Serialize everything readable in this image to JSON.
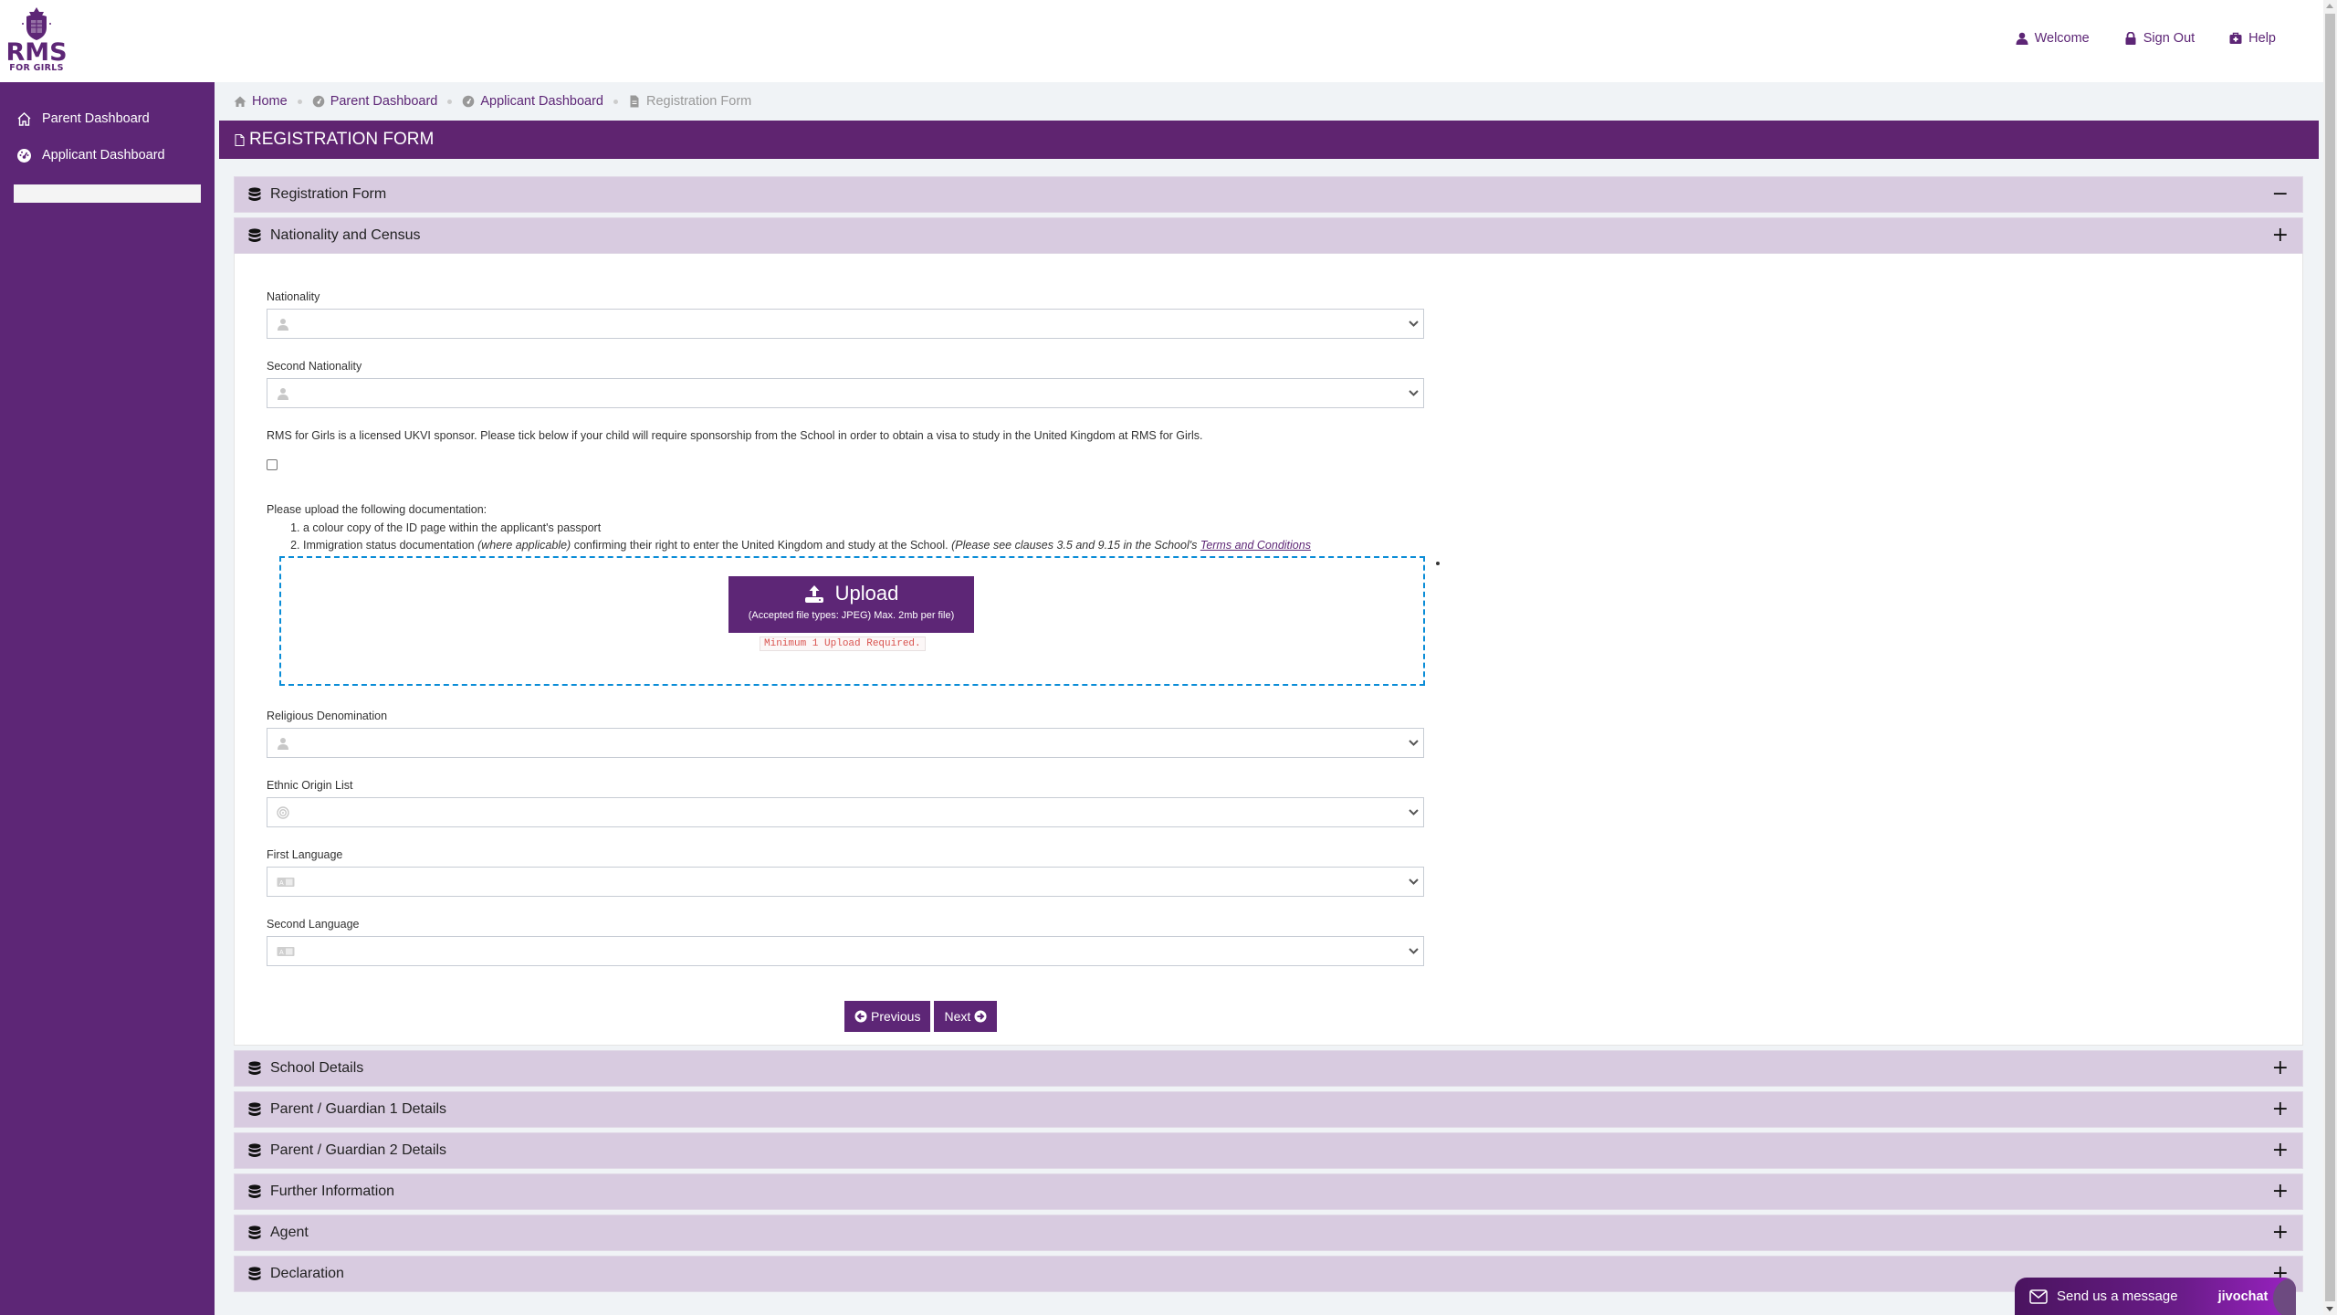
{
  "brand": {
    "name": "RMS",
    "tagline": "FOR GIRLS",
    "accent_color": "#5d2676"
  },
  "top_nav": [
    {
      "label": "Welcome",
      "icon": "user-icon"
    },
    {
      "label": "Sign Out",
      "icon": "lock-icon"
    },
    {
      "label": "Help",
      "icon": "medkit-icon"
    }
  ],
  "sidebar": {
    "items": [
      {
        "label": "Parent Dashboard",
        "icon": "home-icon"
      },
      {
        "label": "Applicant Dashboard",
        "icon": "dashboard-icon"
      }
    ],
    "search_value": ""
  },
  "breadcrumb": [
    {
      "label": "Home",
      "icon": "home-icon"
    },
    {
      "label": "Parent Dashboard",
      "icon": "dashboard-icon"
    },
    {
      "label": "Applicant Dashboard",
      "icon": "dashboard-icon"
    },
    {
      "label": "Registration Form",
      "icon": "file-icon",
      "current": true
    }
  ],
  "page_title": "REGISTRATION FORM",
  "sections": {
    "registration_form": {
      "title": "Registration Form",
      "state": "expanded",
      "toggle": "−"
    },
    "nationality": {
      "title": "Nationality and Census",
      "state": "open",
      "toggle": "+"
    },
    "collapsed": [
      {
        "title": "School Details",
        "toggle": "+"
      },
      {
        "title": "Parent / Guardian 1 Details",
        "toggle": "+"
      },
      {
        "title": "Parent / Guardian 2 Details",
        "toggle": "+"
      },
      {
        "title": "Further Information",
        "toggle": "+"
      },
      {
        "title": "Agent",
        "toggle": "+"
      },
      {
        "title": "Declaration",
        "toggle": "+"
      }
    ]
  },
  "form": {
    "nationality": {
      "label": "Nationality",
      "value": ""
    },
    "second_nationality": {
      "label": "Second Nationality",
      "value": ""
    },
    "sponsor_text": "RMS for Girls is a licensed UKVI sponsor. Please tick below if your child will require sponsorship from the School in order to obtain a visa to study in the United Kingdom at RMS for Girls.",
    "sponsor_checked": false,
    "docs_intro": "Please upload the following documentation:",
    "docs_item1": "a colour copy of the ID page within the applicant's passport",
    "docs_item2_a": "Immigration status documentation ",
    "docs_item2_b": "(where applicable)",
    "docs_item2_c": " confirming their right to enter the United Kingdom and study at the School. ",
    "docs_item2_d": "(Please see clauses 3.5 and 9.15 in the School's ",
    "docs_item2_link": "Terms and Conditions",
    "upload": {
      "label": "Upload",
      "sub": "(Accepted file types: JPEG) Max. 2mb per file)",
      "error": "Minimum 1 Upload Required."
    },
    "religious_denomination": {
      "label": "Religious Denomination",
      "value": ""
    },
    "ethnic_origin": {
      "label": "Ethnic Origin List",
      "value": ""
    },
    "first_language": {
      "label": "First Language",
      "value": ""
    },
    "second_language": {
      "label": "Second Language",
      "value": ""
    },
    "previous_label": "Previous",
    "next_label": "Next"
  },
  "chat": {
    "label": "Send us a message",
    "brand": "jivochat"
  }
}
